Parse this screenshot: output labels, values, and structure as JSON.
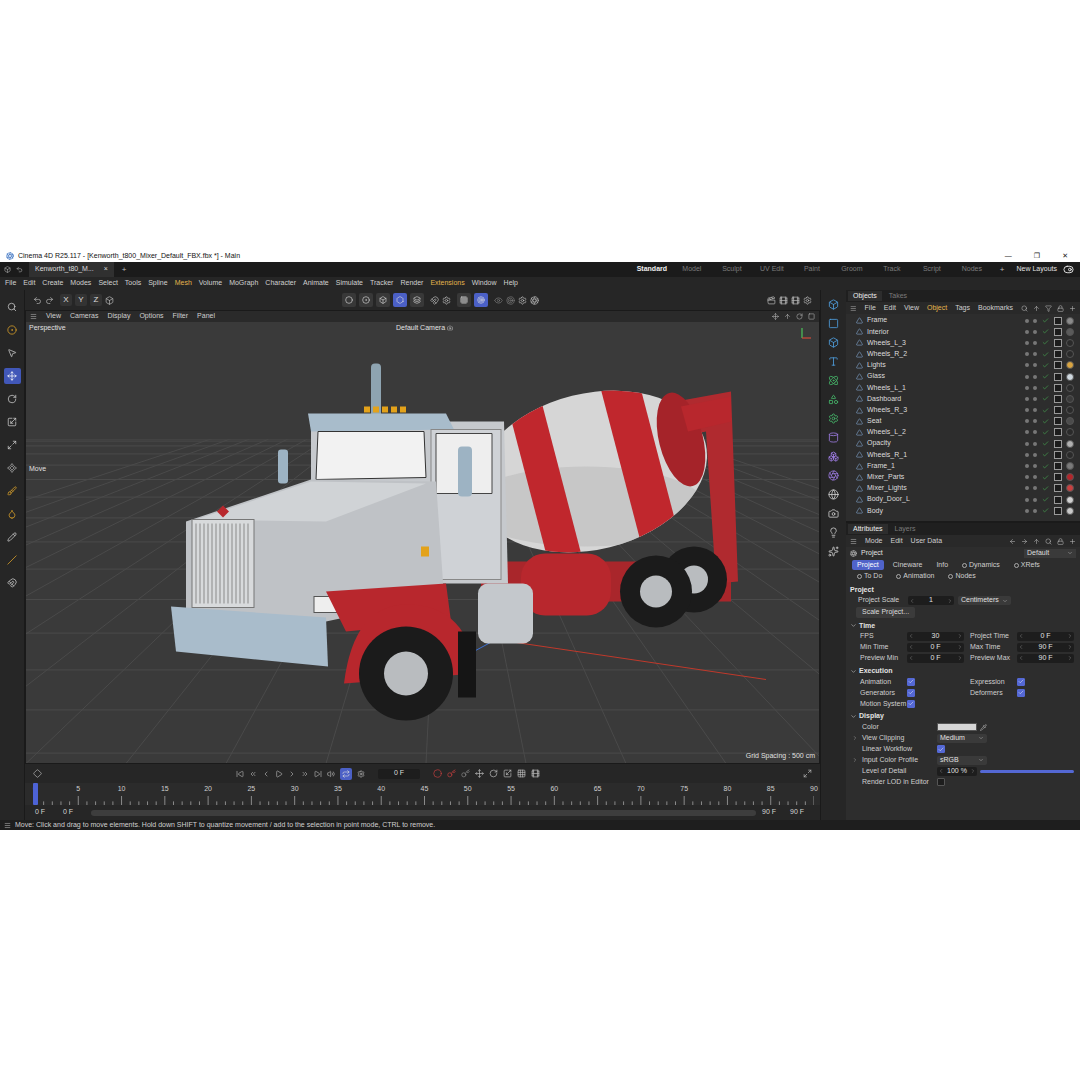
{
  "window": {
    "title": "Cinema 4D R25.117 - [Kenworth_t800_Mixer_Default_FBX.fbx *] - Main",
    "controls": [
      "—",
      "❐",
      "✕"
    ]
  },
  "doc_tabs": [
    {
      "label": "Kenworth_t80_M...",
      "selected": true,
      "close": "×"
    }
  ],
  "new_tab": "+",
  "layouts": [
    {
      "label": "Standard",
      "selected": true
    },
    {
      "label": "Model",
      "selected": false
    },
    {
      "label": "Sculpt",
      "selected": false
    },
    {
      "label": "UV Edit",
      "selected": false
    },
    {
      "label": "Paint",
      "selected": false
    },
    {
      "label": "Groom",
      "selected": false
    },
    {
      "label": "Track",
      "selected": false
    },
    {
      "label": "Script",
      "selected": false
    },
    {
      "label": "Nodes",
      "selected": false
    }
  ],
  "layouts_add": "+",
  "new_layouts": "New Layouts",
  "layout_toggle": {
    "on": true
  },
  "menu": [
    {
      "label": "File",
      "highlighted": false
    },
    {
      "label": "Edit",
      "highlighted": false
    },
    {
      "label": "Create",
      "highlighted": false
    },
    {
      "label": "Modes",
      "highlighted": false
    },
    {
      "label": "Select",
      "highlighted": false
    },
    {
      "label": "Tools",
      "highlighted": false
    },
    {
      "label": "Spline",
      "highlighted": false
    },
    {
      "label": "Mesh",
      "highlighted": true
    },
    {
      "label": "Volume",
      "highlighted": false
    },
    {
      "label": "MoGraph",
      "highlighted": false
    },
    {
      "label": "Character",
      "highlighted": false
    },
    {
      "label": "Animate",
      "highlighted": false
    },
    {
      "label": "Simulate",
      "highlighted": false
    },
    {
      "label": "Tracker",
      "highlighted": false
    },
    {
      "label": "Render",
      "highlighted": false
    },
    {
      "label": "Extensions",
      "highlighted": true
    },
    {
      "label": "Window",
      "highlighted": false
    },
    {
      "label": "Help",
      "highlighted": false
    }
  ],
  "left_tools": [
    {
      "selected": false
    },
    {
      "selected": false
    },
    {
      "selected": false
    },
    {
      "selected": true
    },
    {
      "selected": false
    },
    {
      "selected": false
    },
    {
      "selected": false
    },
    {
      "selected": false
    },
    {
      "selected": false
    },
    {
      "selected": false
    },
    {
      "selected": false
    },
    {
      "selected": false
    },
    {
      "selected": false
    }
  ],
  "toolbar": {
    "axes": [
      {
        "label": "X",
        "selected": false
      },
      {
        "label": "Y",
        "selected": false
      },
      {
        "label": "Z",
        "selected": false
      }
    ],
    "modes": [
      {
        "selected": false
      },
      {
        "selected": false
      },
      {
        "selected": false
      },
      {
        "selected": true
      },
      {
        "selected": false
      }
    ],
    "snaps": [
      {
        "selected": false
      },
      {
        "selected": true
      }
    ]
  },
  "viewport": {
    "menu": [
      "View",
      "Cameras",
      "Display",
      "Options",
      "Filter",
      "Panel"
    ],
    "projection": "Perspective",
    "camera": "Default Camera",
    "tool_label": "Move",
    "grid_spacing": "Grid Spacing : 500 cm"
  },
  "timeline": {
    "current_frame": "0 F",
    "loop": {
      "on": true
    },
    "ticks": [
      "0",
      "5",
      "10",
      "15",
      "20",
      "25",
      "30",
      "35",
      "40",
      "45",
      "50",
      "55",
      "60",
      "65",
      "70",
      "75",
      "80",
      "85",
      "90"
    ],
    "playhead_level": 0,
    "range": {
      "start": "0 F",
      "preview_start": "0 F",
      "preview_end": "90 F",
      "end": "90 F"
    }
  },
  "objects": {
    "tabs": [
      {
        "label": "Objects",
        "selected": true
      },
      {
        "label": "Takes",
        "selected": false
      }
    ],
    "menu": [
      {
        "label": "File",
        "highlighted": false
      },
      {
        "label": "Edit",
        "highlighted": false
      },
      {
        "label": "View",
        "highlighted": false
      },
      {
        "label": "Object",
        "highlighted": true
      },
      {
        "label": "Tags",
        "highlighted": false
      },
      {
        "label": "Bookmarks",
        "highlighted": false
      }
    ],
    "items": [
      {
        "name": "Frame",
        "enabled": true,
        "color": "#8a8a8a"
      },
      {
        "name": "Interior",
        "enabled": true,
        "color": "#5a5a5a"
      },
      {
        "name": "Wheels_L_3",
        "enabled": true,
        "color": "#2a2a2a"
      },
      {
        "name": "Wheels_R_2",
        "enabled": true,
        "color": "#2a2a2a"
      },
      {
        "name": "Lights",
        "enabled": true,
        "color": "#d9a441"
      },
      {
        "name": "Glass",
        "enabled": true,
        "color": "#cfd8df"
      },
      {
        "name": "Wheels_L_1",
        "enabled": true,
        "color": "#2a2a2a"
      },
      {
        "name": "Dashboard",
        "enabled": true,
        "color": "#3a3a3a"
      },
      {
        "name": "Wheels_R_3",
        "enabled": true,
        "color": "#2a2a2a"
      },
      {
        "name": "Seat",
        "enabled": true,
        "color": "#4b4b4b"
      },
      {
        "name": "Wheels_L_2",
        "enabled": true,
        "color": "#2a2a2a"
      },
      {
        "name": "Opacity",
        "enabled": true,
        "color": "#b0b0b0"
      },
      {
        "name": "Wheels_R_1",
        "enabled": true,
        "color": "#2a2a2a"
      },
      {
        "name": "Frame_1",
        "enabled": true,
        "color": "#7a7a7a"
      },
      {
        "name": "Mixer_Parts",
        "enabled": true,
        "color": "#b3262b"
      },
      {
        "name": "Mixer_Lights",
        "enabled": true,
        "color": "#c84040"
      },
      {
        "name": "Body_Door_L",
        "enabled": true,
        "color": "#d0d0d0"
      },
      {
        "name": "Body",
        "enabled": true,
        "color": "#c9c9c9"
      }
    ]
  },
  "attributes": {
    "tabs": [
      {
        "label": "Attributes",
        "selected": true
      },
      {
        "label": "Layers",
        "selected": false
      }
    ],
    "menu": [
      "Mode",
      "Edit",
      "User Data"
    ],
    "object": "Project",
    "preset": "Default",
    "subtabs": [
      {
        "label": "Project",
        "selected": true,
        "marker": false
      },
      {
        "label": "Cineware",
        "selected": false,
        "marker": false
      },
      {
        "label": "Info",
        "selected": false,
        "marker": false
      },
      {
        "label": "Dynamics",
        "selected": false,
        "marker": true
      },
      {
        "label": "XRefs",
        "selected": false,
        "marker": true
      },
      {
        "label": "To Do",
        "selected": false,
        "marker": true
      },
      {
        "label": "Animation",
        "selected": false,
        "marker": true
      },
      {
        "label": "Nodes",
        "selected": false,
        "marker": true
      }
    ],
    "heading": "Project",
    "project_scale": {
      "label": "Project Scale",
      "value": "1",
      "unit": "Centimeters"
    },
    "scale_button": "Scale Project...",
    "sections": [
      {
        "title": "Time",
        "expanded": true,
        "kind": "pairs",
        "fields": [
          {
            "kind": "number",
            "label": "FPS",
            "value": "30"
          },
          {
            "kind": "number",
            "label": "Project Time",
            "value": "0 F"
          },
          {
            "kind": "number",
            "label": "Min Time",
            "value": "0 F"
          },
          {
            "kind": "number",
            "label": "Max Time",
            "value": "90 F"
          },
          {
            "kind": "number",
            "label": "Preview Min",
            "value": "0 F"
          },
          {
            "kind": "number",
            "label": "Preview Max",
            "value": "90 F"
          }
        ]
      },
      {
        "title": "Execution",
        "expanded": true,
        "kind": "pairs",
        "fields": [
          {
            "kind": "check",
            "label": "Animation",
            "checked": true
          },
          {
            "kind": "check",
            "label": "Expression",
            "checked": true
          },
          {
            "kind": "check",
            "label": "Generators",
            "checked": true
          },
          {
            "kind": "check",
            "label": "Deformers",
            "checked": true
          },
          {
            "kind": "check",
            "label": "Motion System",
            "checked": true
          }
        ]
      },
      {
        "title": "Display",
        "expanded": true,
        "kind": "list",
        "fields": [
          {
            "kind": "color",
            "label": "Color",
            "color": "#d6d6d6",
            "expandable": false
          },
          {
            "kind": "dropdown",
            "label": "View Clipping",
            "value": "Medium",
            "expandable": true
          },
          {
            "kind": "check",
            "label": "Linear Workflow",
            "checked": true,
            "expandable": false
          },
          {
            "kind": "dropdown",
            "label": "Input Color Profile",
            "value": "sRGB",
            "expandable": true
          },
          {
            "kind": "slider",
            "label": "Level of Detail",
            "value": "100 %",
            "level": 1,
            "expandable": false
          },
          {
            "kind": "check",
            "label": "Render LOD in Editor",
            "checked": false,
            "expandable": false
          }
        ]
      }
    ]
  },
  "status_bar": "Move: Click and drag to move elements. Hold down SHIFT to quantize movement / add to the selection in point mode, CTRL to remove."
}
